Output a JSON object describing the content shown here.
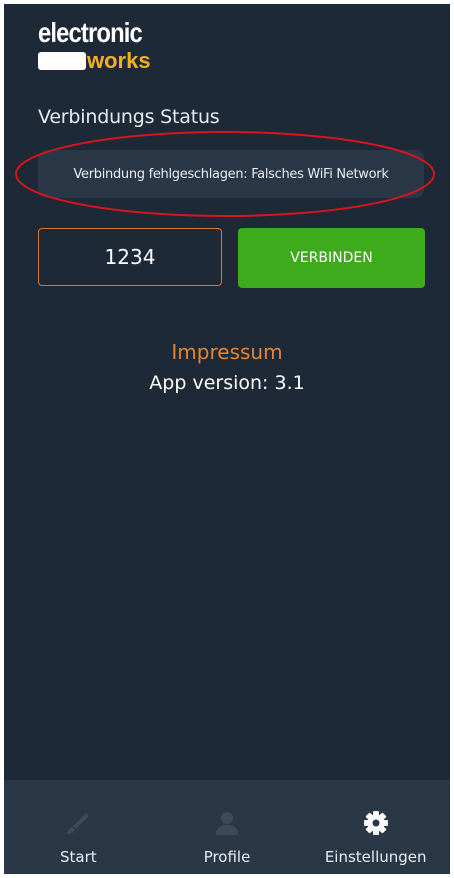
{
  "logo": {
    "line1": "electronic",
    "line2": "works"
  },
  "status": {
    "title": "Verbindungs Status",
    "message": "Verbindung fehlgeschlagen: Falsches WiFi Network"
  },
  "connect": {
    "code_value": "1234",
    "button_label": "VERBINDEN"
  },
  "info": {
    "impressum": "Impressum",
    "version": "App version: 3.1"
  },
  "nav": {
    "items": [
      {
        "label": "Start",
        "icon": "brush-icon"
      },
      {
        "label": "Profile",
        "icon": "person-icon"
      },
      {
        "label": "Einstellungen",
        "icon": "gear-icon",
        "active": true
      }
    ]
  },
  "colors": {
    "background": "#1d2936",
    "panel": "#2a3746",
    "accent_orange": "#e9842e",
    "button_green": "#3eab1c",
    "annotation_red": "#d8141d",
    "logo_yellow": "#f3b21b"
  }
}
